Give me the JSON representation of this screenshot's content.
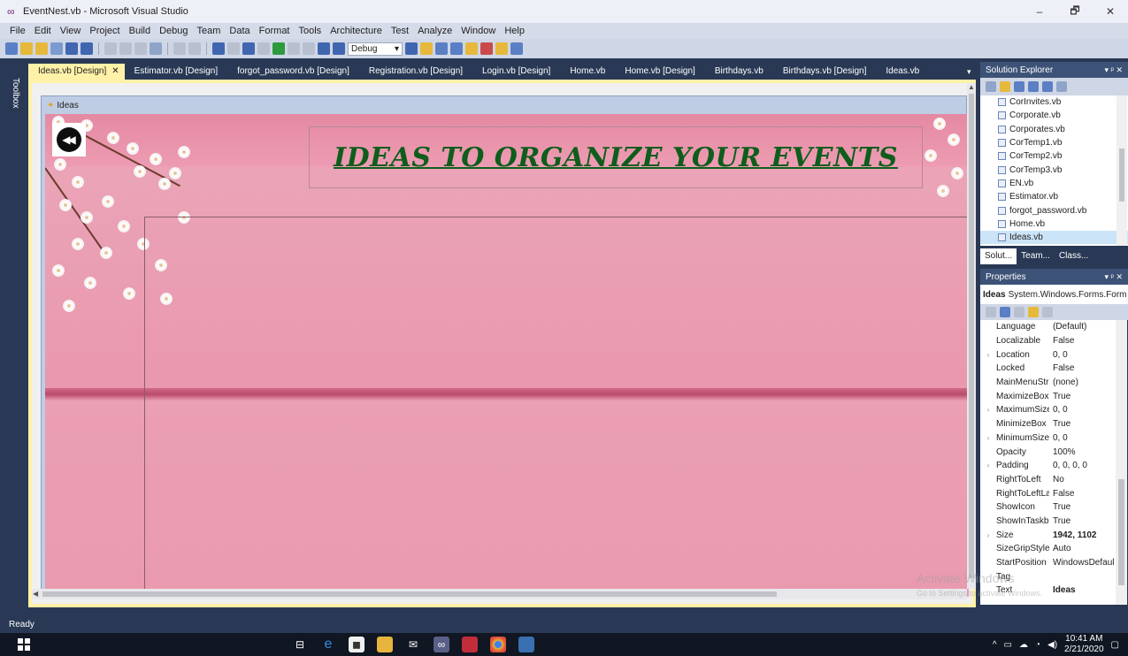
{
  "window": {
    "title": "EventNest.vb - Microsoft Visual Studio",
    "controls": [
      "–",
      "🗗",
      "✕"
    ]
  },
  "menu": [
    "File",
    "Edit",
    "View",
    "Project",
    "Build",
    "Debug",
    "Team",
    "Data",
    "Format",
    "Tools",
    "Architecture",
    "Test",
    "Analyze",
    "Window",
    "Help"
  ],
  "toolbar": {
    "config": "Debug"
  },
  "toolbox_label": "Toolbox",
  "doc_tabs": [
    {
      "label": "Ideas.vb [Design]",
      "active": true
    },
    {
      "label": "Estimator.vb [Design]"
    },
    {
      "label": "forgot_password.vb [Design]"
    },
    {
      "label": "Registration.vb [Design]"
    },
    {
      "label": "Login.vb [Design]"
    },
    {
      "label": "Home.vb"
    },
    {
      "label": "Home.vb [Design]"
    },
    {
      "label": "Birthdays.vb"
    },
    {
      "label": "Birthdays.vb [Design]"
    },
    {
      "label": "Ideas.vb"
    }
  ],
  "designer": {
    "form_title": "Ideas",
    "heading": "IDEAS TO ORGANIZE YOUR EVENTS"
  },
  "solution_explorer": {
    "title": "Solution Explorer",
    "files": [
      "CorInvites.vb",
      "Corporate.vb",
      "Corporates.vb",
      "CorTemp1.vb",
      "CorTemp2.vb",
      "CorTemp3.vb",
      "EN.vb",
      "Estimator.vb",
      "forgot_password.vb",
      "Home.vb",
      "Ideas.vb"
    ],
    "selected": "Ideas.vb",
    "tabs": [
      "Solut...",
      "Team...",
      "Class..."
    ]
  },
  "properties": {
    "title": "Properties",
    "object_name": "Ideas",
    "object_type": "System.Windows.Forms.Form",
    "rows": [
      {
        "name": "Language",
        "value": "(Default)"
      },
      {
        "name": "Localizable",
        "value": "False"
      },
      {
        "name": "Location",
        "value": "0, 0",
        "expandable": true
      },
      {
        "name": "Locked",
        "value": "False"
      },
      {
        "name": "MainMenuStri",
        "value": "(none)"
      },
      {
        "name": "MaximizeBox",
        "value": "True"
      },
      {
        "name": "MaximumSize",
        "value": "0, 0",
        "expandable": true
      },
      {
        "name": "MinimizeBox",
        "value": "True"
      },
      {
        "name": "MinimumSize",
        "value": "0, 0",
        "expandable": true
      },
      {
        "name": "Opacity",
        "value": "100%"
      },
      {
        "name": "Padding",
        "value": "0, 0, 0, 0",
        "expandable": true
      },
      {
        "name": "RightToLeft",
        "value": "No"
      },
      {
        "name": "RightToLeftLa",
        "value": "False"
      },
      {
        "name": "ShowIcon",
        "value": "True"
      },
      {
        "name": "ShowInTaskba",
        "value": "True"
      },
      {
        "name": "Size",
        "value": "1942, 1102",
        "expandable": true,
        "bold": true
      },
      {
        "name": "SizeGripStyle",
        "value": "Auto"
      },
      {
        "name": "StartPosition",
        "value": "WindowsDefaul"
      },
      {
        "name": "Tag",
        "value": ""
      },
      {
        "name": "Text",
        "value": "Ideas",
        "bold": true
      }
    ]
  },
  "watermark": {
    "line1": "Activate Windows",
    "line2": "Go to Settings to activate Windows."
  },
  "status": "Ready",
  "taskbar": {
    "time": "10:41 AM",
    "date": "2/21/2020"
  },
  "colors": {
    "shell": "#293955",
    "active_tab": "#fff1a8",
    "heading": "#0f5d1c",
    "wood": "#e99aae"
  }
}
